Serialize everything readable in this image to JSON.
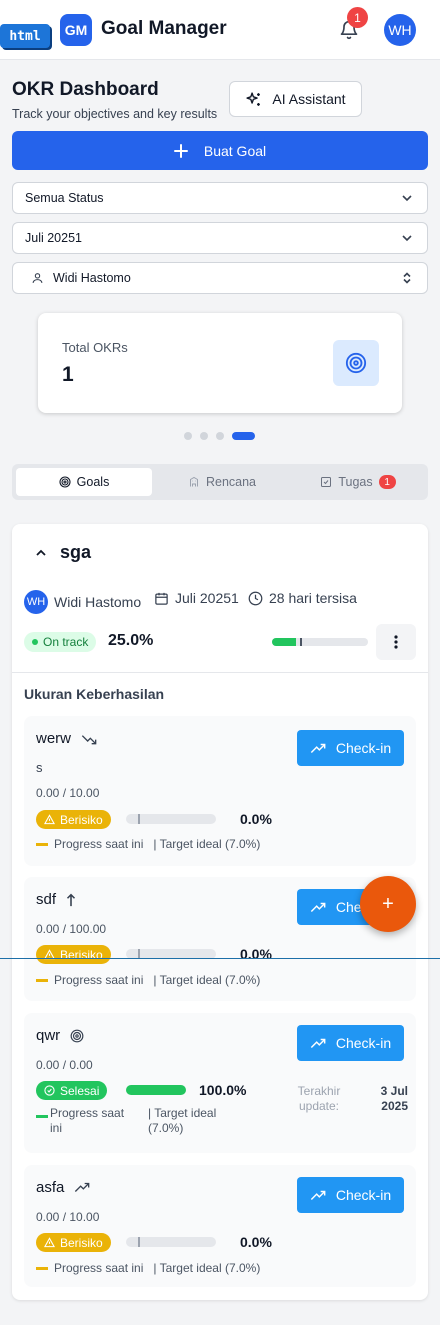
{
  "brand": {
    "overlay_tag": "html",
    "logo_text": "GM",
    "title": "Goal Manager"
  },
  "notifications": {
    "count": "1"
  },
  "user": {
    "initials": "WH"
  },
  "dashboard": {
    "title": "OKR Dashboard",
    "subtitle": "Track your objectives and key results",
    "ai_label": "AI Assistant",
    "create_label": "Buat Goal"
  },
  "filters": {
    "status": "Semua Status",
    "period": "Juli 20251",
    "owner": "Widi Hastomo"
  },
  "kpi": {
    "label": "Total OKRs",
    "value": "1",
    "carousel_active_index": 3
  },
  "tabs": [
    {
      "label": "Goals",
      "badge": ""
    },
    {
      "label": "Rencana",
      "badge": ""
    },
    {
      "label": "Tugas",
      "badge": "1"
    }
  ],
  "goal": {
    "name": "sga",
    "owner": "Widi Hastomo",
    "owner_initials": "WH",
    "period": "Juli 20251",
    "remaining": "28 hari tersisa",
    "status": "On track",
    "progress_text": "25.0%",
    "progress_value": 25.0,
    "ideal_marker": 29.0,
    "section_title": "Ukuran Keberhasilan"
  },
  "key_results": [
    {
      "name": "werw",
      "trend_icon": "trend-down-icon",
      "subtitle": "s",
      "value_text": "0.00 / 10.00",
      "status": "Berisiko",
      "progress_text": "0.0%",
      "progress": 0,
      "legend_current": "Progress saat ini",
      "legend_ideal": "| Target ideal (7.0%)",
      "checkin_label": "Check-in"
    },
    {
      "name": "sdf",
      "trend_icon": "arrow-up-icon",
      "subtitle": "",
      "value_text": "0.00 / 100.00",
      "status": "Berisiko",
      "progress_text": "0.0%",
      "progress": 0,
      "legend_current": "Progress saat ini",
      "legend_ideal": "| Target ideal (7.0%)",
      "checkin_label": "Check-in"
    },
    {
      "name": "qwr",
      "trend_icon": "target-icon",
      "subtitle": "",
      "value_text": "0.00 / 0.00",
      "status": "Selesai",
      "progress_text": "100.0%",
      "progress": 100,
      "legend_current": "Progress saat ini",
      "legend_ideal": "| Target ideal (7.0%)",
      "checkin_label": "Check-in",
      "update_label": "Terakhir update:",
      "update_date": "3 Jul 2025"
    },
    {
      "name": "asfa",
      "trend_icon": "trend-up-icon",
      "subtitle": "",
      "value_text": "0.00 / 10.00",
      "status": "Berisiko",
      "progress_text": "0.0%",
      "progress": 0,
      "legend_current": "Progress saat ini",
      "legend_ideal": "| Target ideal (7.0%)",
      "checkin_label": "Check-in"
    }
  ],
  "fab": {
    "label": "+"
  },
  "colors": {
    "primary": "#2563eb",
    "risk": "#eab308",
    "done": "#22c55e",
    "fab": "#ea580c",
    "checkin": "#2196f3"
  }
}
